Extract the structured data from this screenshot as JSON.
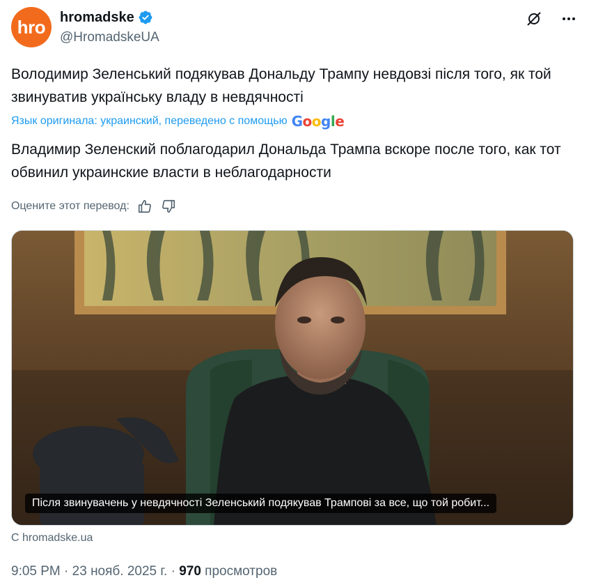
{
  "account": {
    "avatar_text": "hro",
    "display_name": "hromadske",
    "handle": "@HromadskeUA",
    "verified_icon": "verified-badge-icon"
  },
  "header_icons": [
    "grok-icon",
    "more-icon"
  ],
  "tweet": {
    "original_text": "Володимир Зеленський подякував Дональду Трампу невдовзі після того, як той звинуватив українську владу в невдячності",
    "translation_note": "Язык оригинала: украинский, переведено с помощью",
    "google_logo": "Google",
    "translated_text": "Владимир Зеленский поблагодарил Дональда Трампа вскоре после того, как тот обвинил украинские власти в неблагодарности",
    "rate_label": "Оцените этот перевод:",
    "rate_icons": [
      "thumbs-up-icon",
      "thumbs-down-icon"
    ]
  },
  "media": {
    "caption": "Після звинувачень у невдячності Зеленський подякував Трампові за все, що той робит...",
    "source": "С hromadske.ua"
  },
  "meta": {
    "time": "9:05 PM",
    "separator": "·",
    "date": "23 нояб. 2025 г.",
    "views": "970",
    "views_label": "просмотров"
  },
  "colors": {
    "accent": "#1d9bf0",
    "avatar": "#f26b1d",
    "muted": "#536471",
    "text": "#0f1419"
  }
}
